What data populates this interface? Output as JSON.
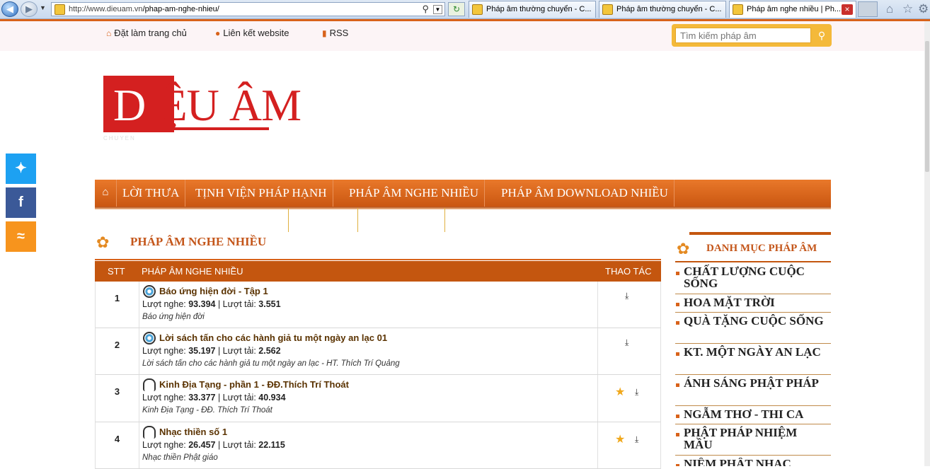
{
  "browser": {
    "url_prefix": "http://www.dieuam.vn",
    "url_path": "/phap-am-nghe-nhieu/",
    "tabs": [
      {
        "label": "Pháp âm thường chuyển - C..."
      },
      {
        "label": "Pháp âm thường chuyển - C..."
      },
      {
        "label": "Pháp âm nghe nhiều | Ph..."
      }
    ]
  },
  "topbar": {
    "home_link": "Đặt làm trang chủ",
    "link_website": "Liên kết website",
    "rss": "RSS",
    "search_placeholder": "Tìm kiếm pháp âm"
  },
  "logo": {
    "part1": "D",
    "part2": "IỆU ÂM",
    "sub": "CHUYEN"
  },
  "social": [
    "twitter",
    "facebook",
    "rss"
  ],
  "nav": {
    "items": [
      "LỜI THƯA",
      "TỊNH VIỆN PHÁP HẠNH",
      "PHÁP ÂM NGHE NHIỀU",
      "PHÁP ÂM DOWNLOAD NHIỀU"
    ]
  },
  "section": {
    "title": "PHÁP ÂM NGHE NHIỀU"
  },
  "table": {
    "headers": {
      "stt": "STT",
      "name": "PHÁP ÂM NGHE NHIỀU",
      "action": "THAO TÁC"
    },
    "listen_label": "Lượt nghe:",
    "download_label": "Lượt tải:",
    "rows": [
      {
        "stt": "1",
        "title": "Báo ứng hiện đời - Tập 1",
        "listens": "93.394",
        "downloads": "3.551",
        "desc": "Báo ứng hiện đời"
      },
      {
        "stt": "2",
        "title": "Lời sách tấn cho các hành giả tu một ngày an lạc 01",
        "listens": "35.197",
        "downloads": "2.562",
        "desc": "Lời sách tấn cho các hành giả tu một ngày an lạc - HT. Thích Trí Quảng"
      },
      {
        "stt": "3",
        "title": "Kinh Địa Tạng - phần 1 - ĐĐ.Thích Trí Thoát",
        "listens": "33.377",
        "downloads": "40.934",
        "desc": "Kinh Địa Tạng - ĐĐ. Thích Trí Thoát"
      },
      {
        "stt": "4",
        "title": "Nhạc thiền số 1",
        "listens": "26.457",
        "downloads": "22.115",
        "desc": "Nhạc thiền Phật giáo"
      }
    ]
  },
  "sidebar": {
    "title": "DANH MỤC PHÁP ÂM",
    "categories": [
      "CHẤT LƯỢNG CUỘC SỐNG",
      "HOA MẶT TRỜI",
      "QUÀ TẶNG CUỘC SỐNG",
      "KT. MỘT NGÀY AN LẠC",
      "ÁNH SÁNG PHẬT PHÁP",
      "NGẪM THƠ - THI CA",
      "PHẬT PHÁP NHIỆM MẦU",
      "NIỆM PHẬT NHẠC"
    ]
  }
}
